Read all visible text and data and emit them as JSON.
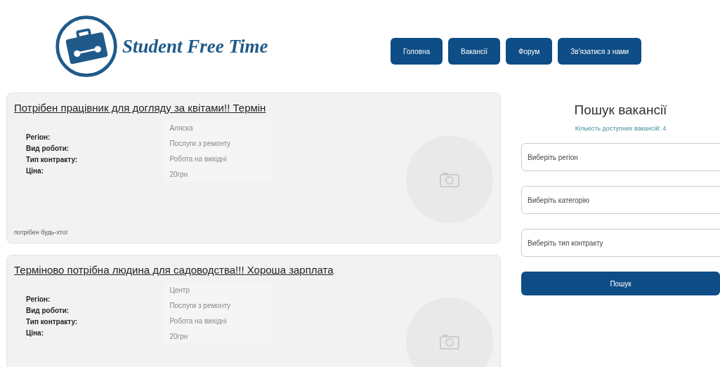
{
  "header": {
    "logo_text": "Student Free Time",
    "nav": [
      {
        "label": "Головна"
      },
      {
        "label": "Вакансії"
      },
      {
        "label": "Форум"
      },
      {
        "label": "Зв'язатися з нами"
      }
    ]
  },
  "vacancies": [
    {
      "title": "Потрібен працівник для догляду за квітами!! Термін",
      "fields": [
        {
          "label": "Регіон:",
          "value": "Аляска"
        },
        {
          "label": "Вид роботи:",
          "value": "Послуги з ремонту"
        },
        {
          "label": "Тип контракту:",
          "value": "Робота на вихідні"
        },
        {
          "label": "Ціна:",
          "value": "20грн"
        }
      ],
      "description": "потрібен будь-хто!"
    },
    {
      "title": "Терміново потрібна людина для садоводства!!! Хороша зарплата",
      "fields": [
        {
          "label": "Регіон:",
          "value": "Центр"
        },
        {
          "label": "Вид роботи:",
          "value": "Послуги з ремонту"
        },
        {
          "label": "Тип контракту:",
          "value": "Робота на вихідні"
        },
        {
          "label": "Ціна:",
          "value": "20грн"
        }
      ]
    }
  ],
  "search": {
    "title": "Пошук вакансії",
    "count": "Кількість доступних вакансій: 4",
    "selects": [
      {
        "placeholder": "Виберіть регіон"
      },
      {
        "placeholder": "Виберіть категорію"
      },
      {
        "placeholder": "Виберіть тип контракту"
      }
    ],
    "button": "Пошук"
  }
}
